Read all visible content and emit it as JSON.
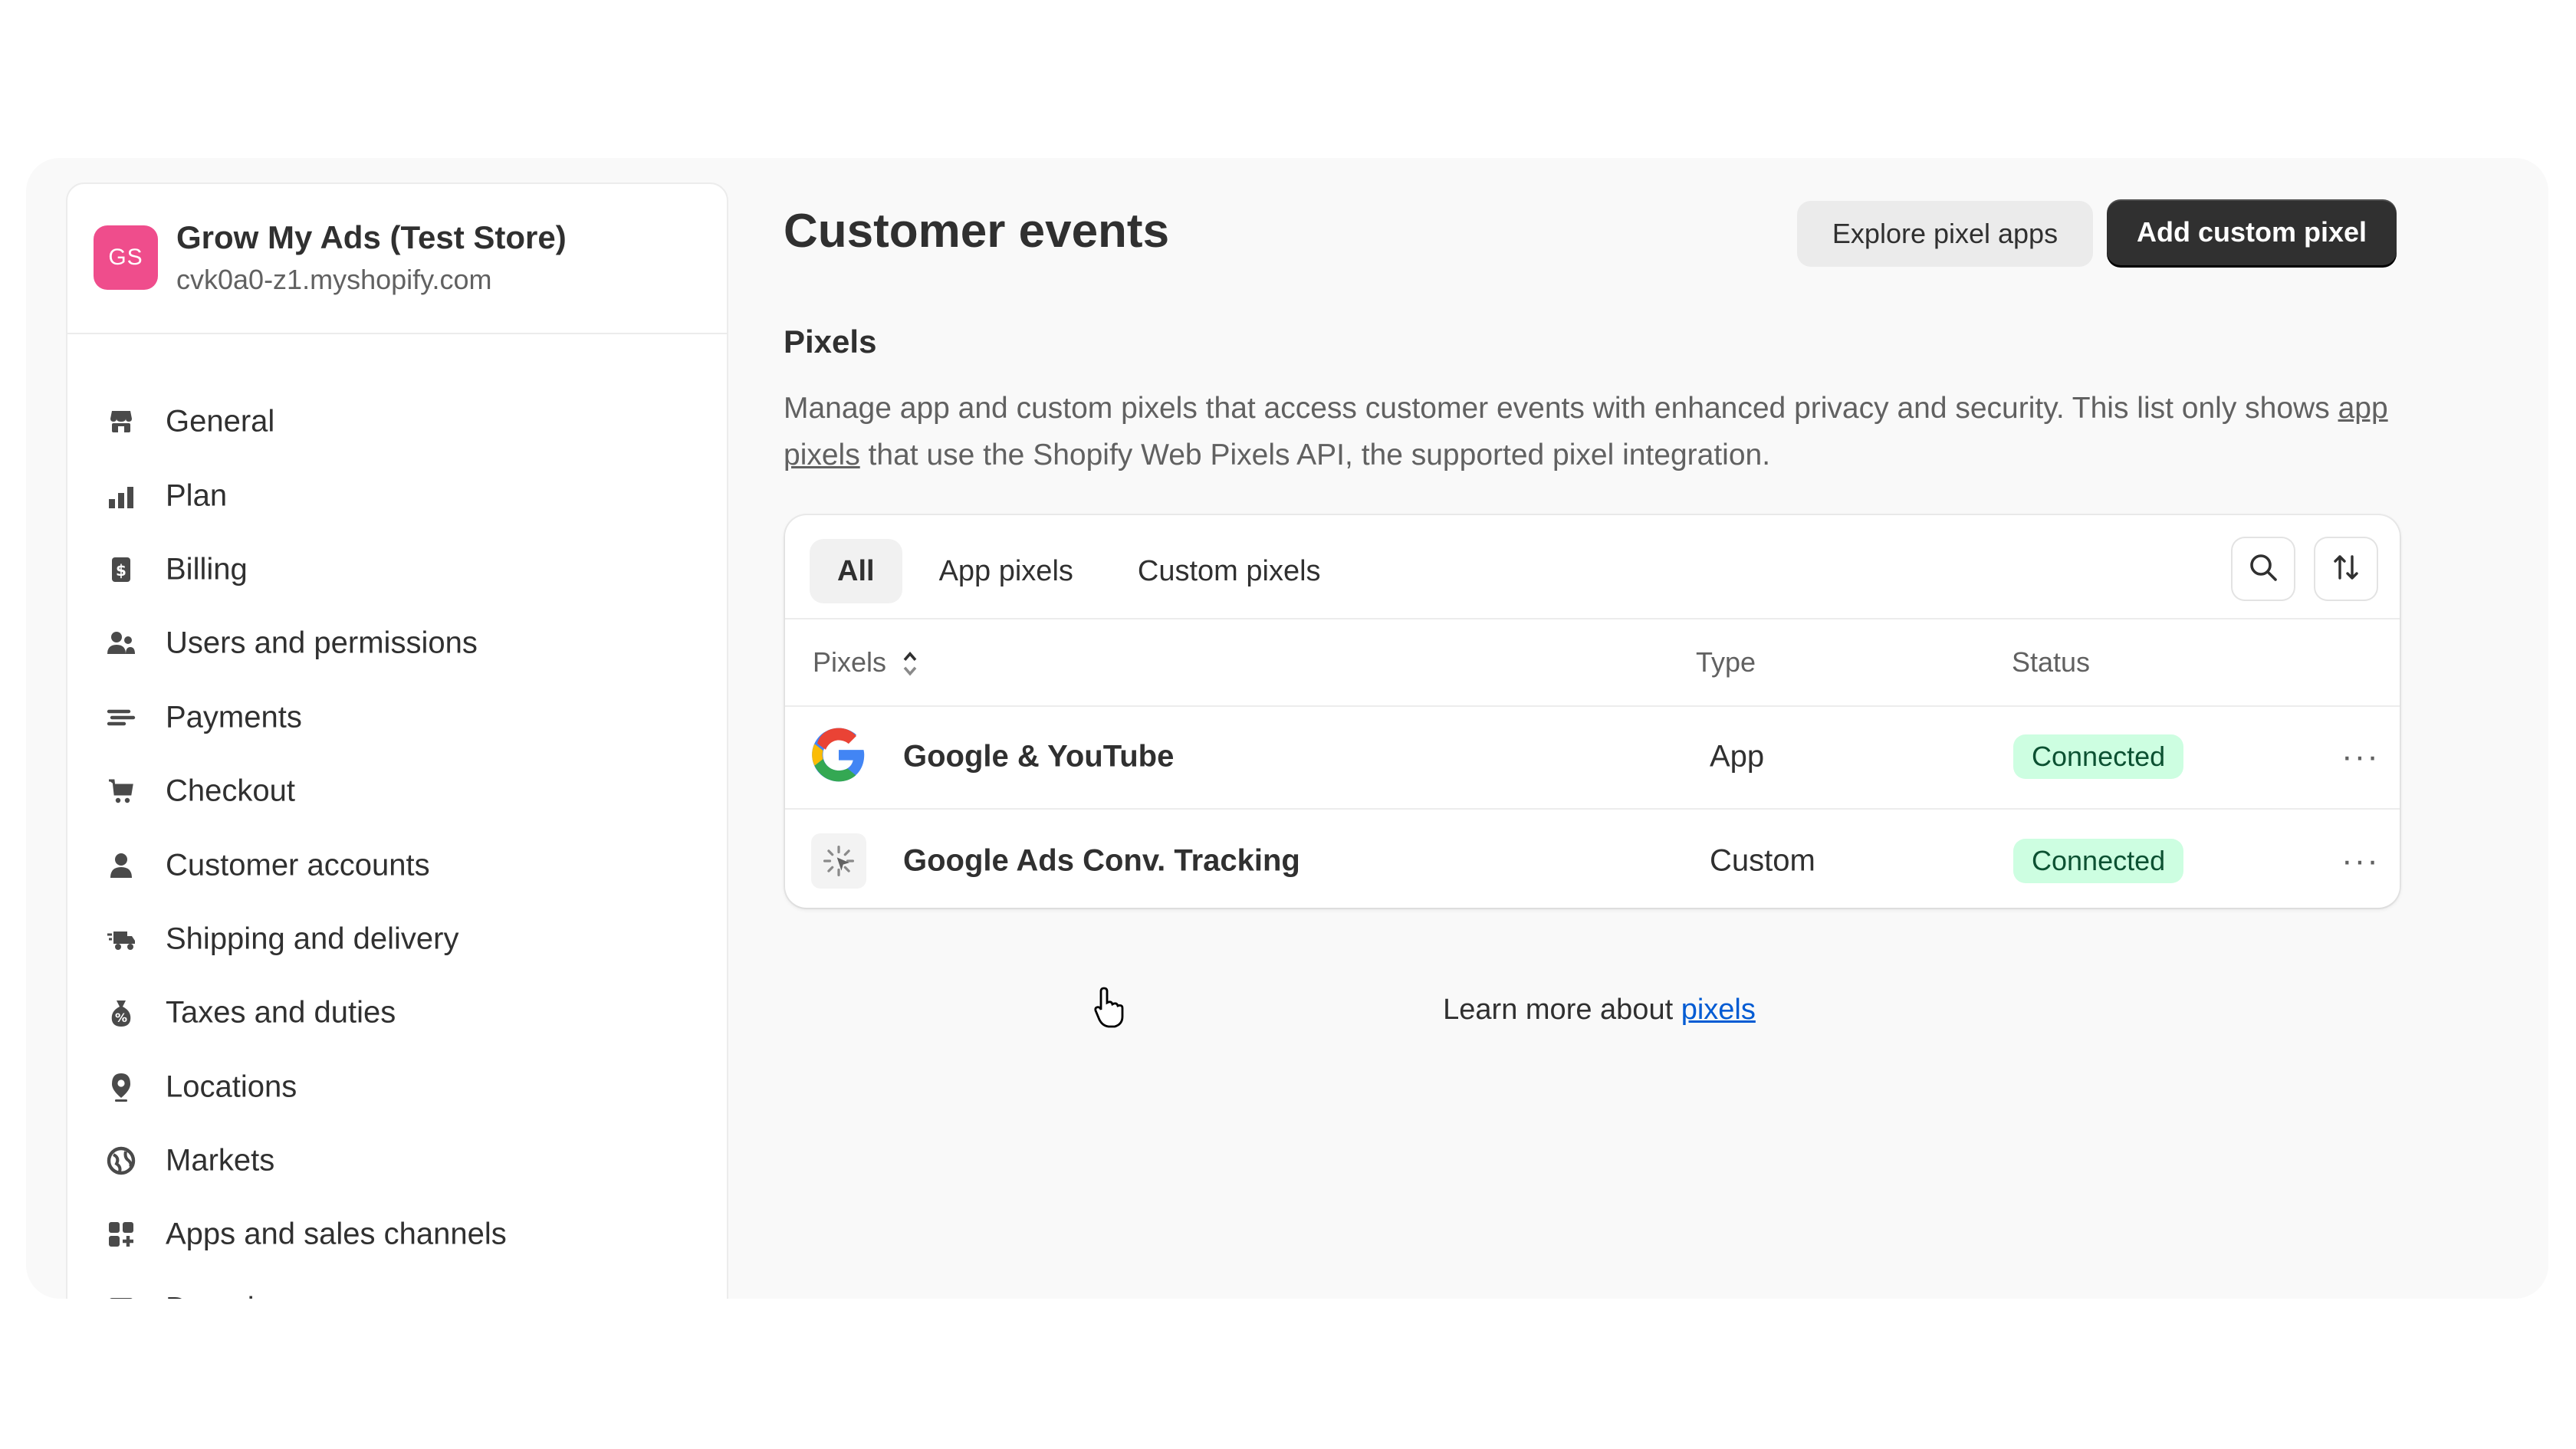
{
  "store": {
    "initials": "GS",
    "name": "Grow My Ads (Test Store)",
    "domain": "cvk0a0-z1.myshopify.com"
  },
  "nav": [
    {
      "label": "General",
      "icon": "store-icon"
    },
    {
      "label": "Plan",
      "icon": "plan-icon"
    },
    {
      "label": "Billing",
      "icon": "billing-icon"
    },
    {
      "label": "Users and permissions",
      "icon": "users-icon"
    },
    {
      "label": "Payments",
      "icon": "payments-icon"
    },
    {
      "label": "Checkout",
      "icon": "cart-icon"
    },
    {
      "label": "Customer accounts",
      "icon": "person-icon"
    },
    {
      "label": "Shipping and delivery",
      "icon": "truck-icon"
    },
    {
      "label": "Taxes and duties",
      "icon": "tax-icon"
    },
    {
      "label": "Locations",
      "icon": "location-icon"
    },
    {
      "label": "Markets",
      "icon": "globe-icon"
    },
    {
      "label": "Apps and sales channels",
      "icon": "apps-icon"
    },
    {
      "label": "Domains",
      "icon": "domains-icon"
    }
  ],
  "page": {
    "title": "Customer events",
    "explore_label": "Explore pixel apps",
    "add_label": "Add custom pixel"
  },
  "pixels_section": {
    "title": "Pixels",
    "description_before": "Manage app and custom pixels that access customer events with enhanced privacy and security. This list only shows ",
    "description_link": "app pixels",
    "description_after": " that use the Shopify Web Pixels API, the supported pixel integration."
  },
  "tabs": [
    {
      "label": "All",
      "active": true
    },
    {
      "label": "App pixels",
      "active": false
    },
    {
      "label": "Custom pixels",
      "active": false
    }
  ],
  "table": {
    "headers": {
      "pixels": "Pixels",
      "type": "Type",
      "status": "Status"
    },
    "rows": [
      {
        "name": "Google & YouTube",
        "type": "App",
        "status": "Connected",
        "icon": "google-logo-icon"
      },
      {
        "name": "Google Ads Conv. Tracking",
        "type": "Custom",
        "status": "Connected",
        "icon": "custom-pixel-icon"
      }
    ]
  },
  "footer": {
    "learn_text": "Learn more about ",
    "learn_link": "pixels"
  },
  "colors": {
    "primary_button": "#303030",
    "status_badge_bg": "#cdfee1",
    "status_badge_text": "#0c5132",
    "link": "#005bd3",
    "avatar": "#ef4d8c"
  }
}
